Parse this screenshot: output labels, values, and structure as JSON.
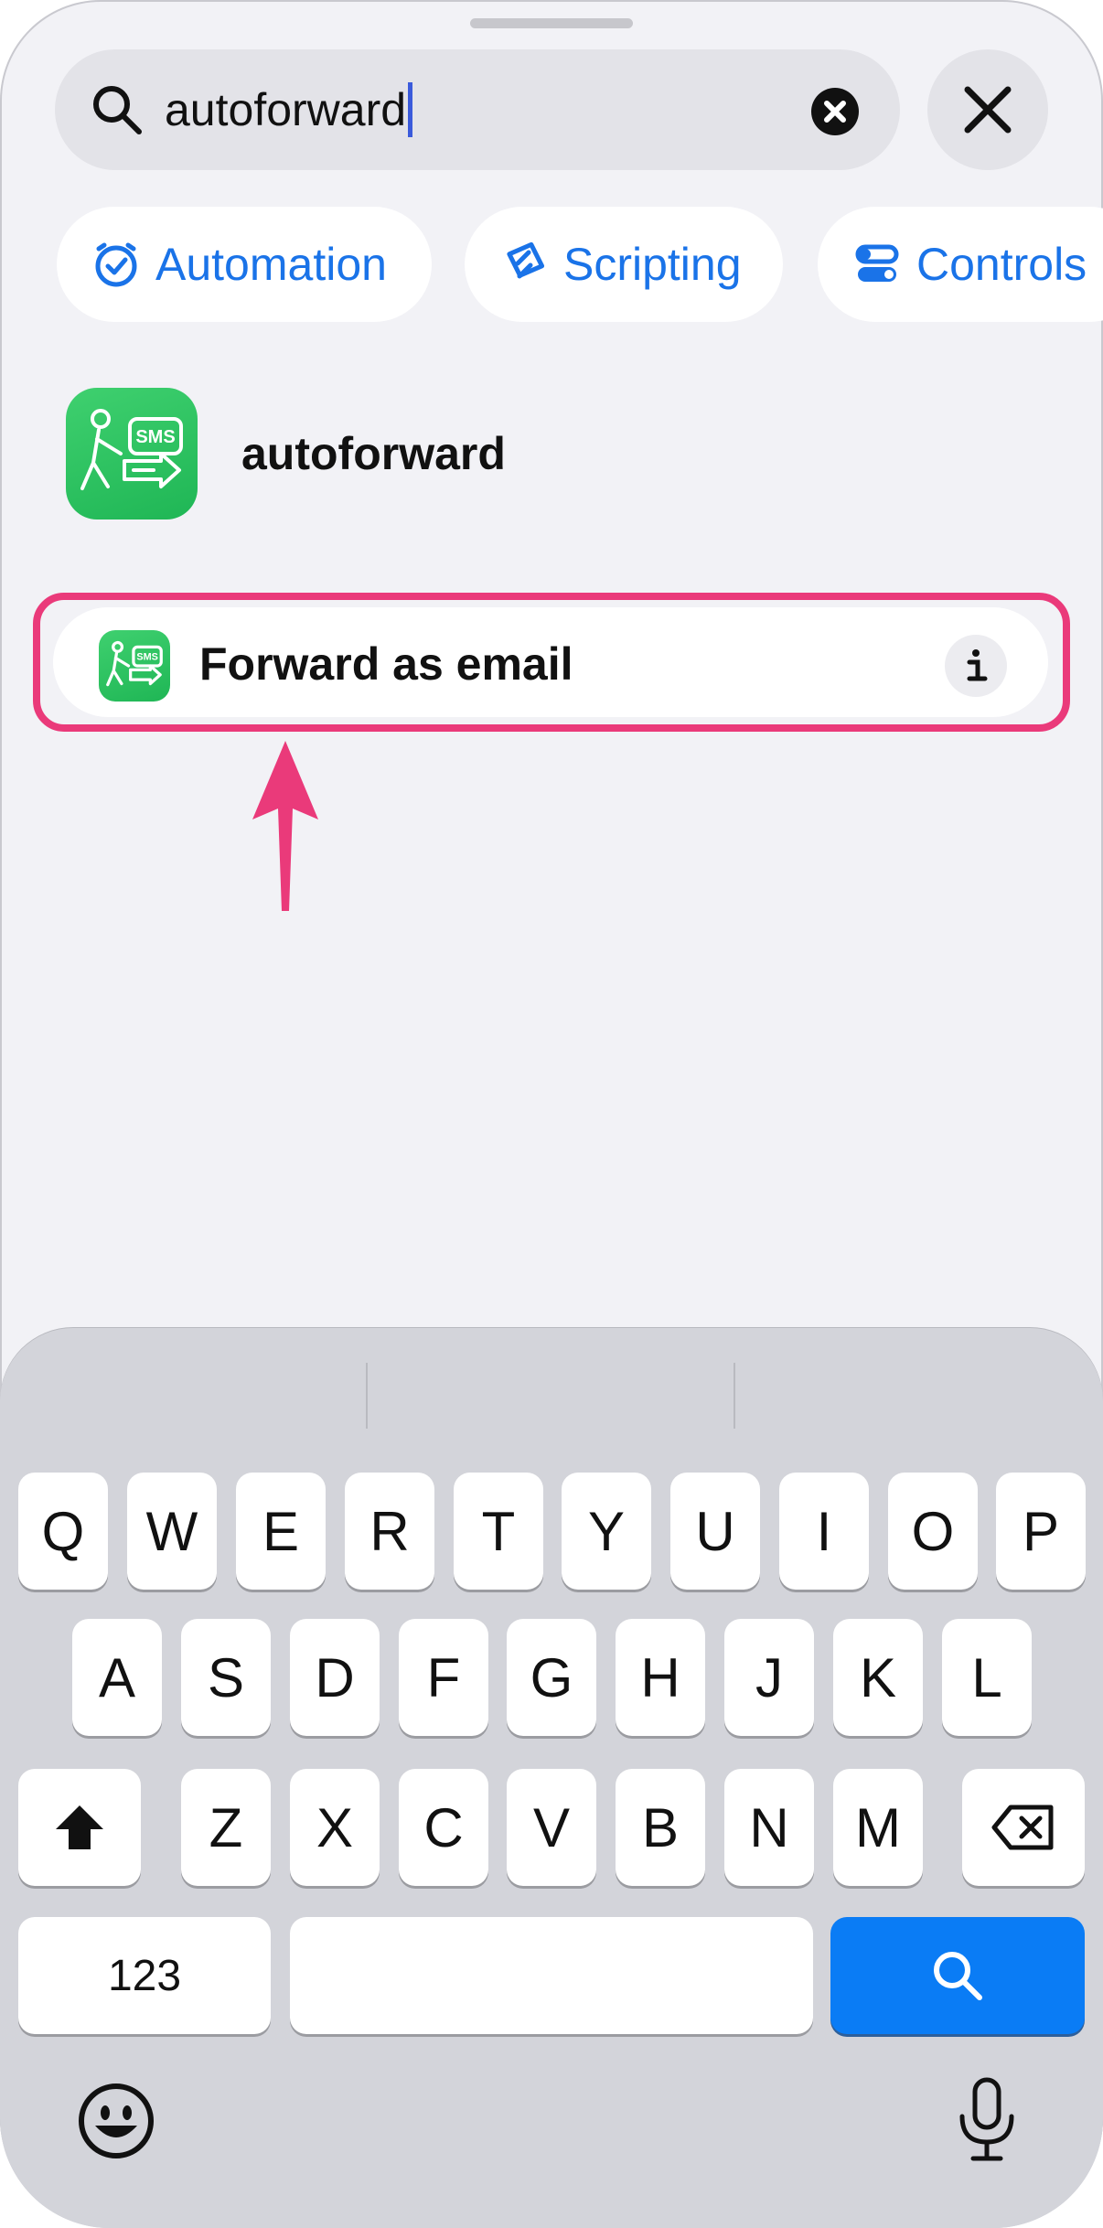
{
  "search": {
    "query": "autoforward",
    "has_clear": true
  },
  "chips": [
    {
      "label": "Automation",
      "icon": "clock-check-icon"
    },
    {
      "label": "Scripting",
      "icon": "scripting-diamond-icon"
    },
    {
      "label": "Controls",
      "icon": "toggles-icon"
    }
  ],
  "app": {
    "name": "autoforward",
    "icon": "sms-forward-app-icon",
    "icon_text": "SMS"
  },
  "result": {
    "label": "Forward as email",
    "info_icon": "info-icon"
  },
  "keyboard": {
    "row1": [
      "Q",
      "W",
      "E",
      "R",
      "T",
      "Y",
      "U",
      "I",
      "O",
      "P"
    ],
    "row2": [
      "A",
      "S",
      "D",
      "F",
      "G",
      "H",
      "J",
      "K",
      "L"
    ],
    "row3": [
      "Z",
      "X",
      "C",
      "V",
      "B",
      "N",
      "M"
    ],
    "numbers_key": "123",
    "shift_icon": "shift-icon",
    "delete_icon": "delete-icon",
    "search_icon": "search-icon",
    "emoji_icon": "emoji-icon",
    "mic_icon": "microphone-icon"
  },
  "colors": {
    "accent": "#1a73e8",
    "highlight": "#ea3a7a",
    "app_green": "#2ec463",
    "search_key": "#0a7cf5"
  }
}
